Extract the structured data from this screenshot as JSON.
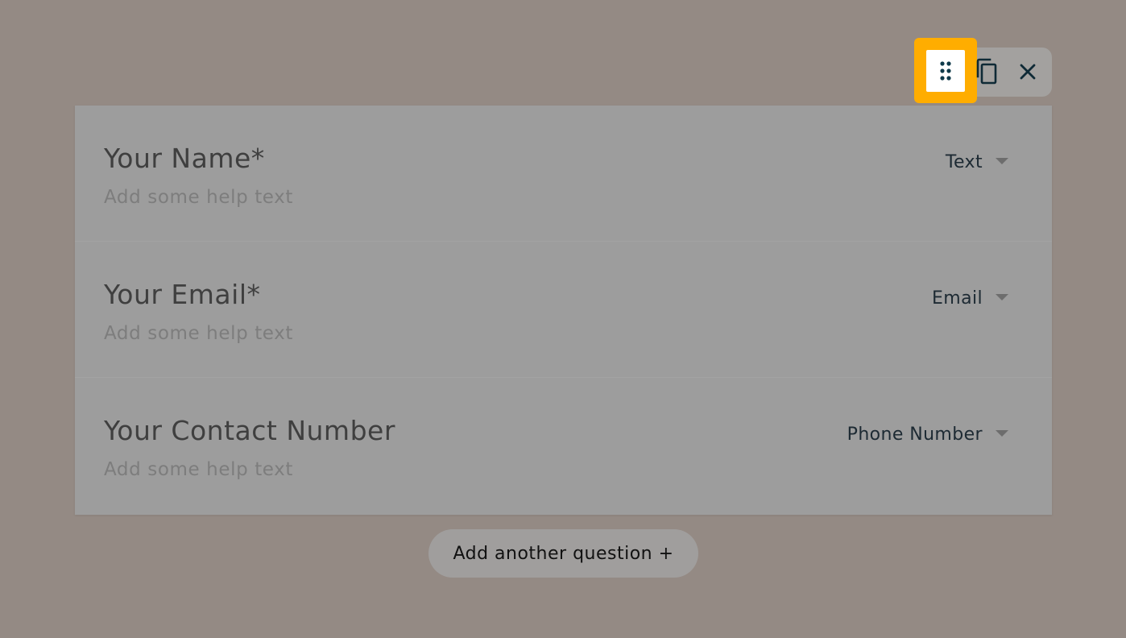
{
  "toolbar": {
    "drag_icon": "drag-handle-icon",
    "copy_icon": "copy-icon",
    "close_icon": "close-icon",
    "highlight_color": "#ffad00"
  },
  "questions": [
    {
      "title": "Your Name*",
      "help_placeholder": "Add some help text",
      "type": "Text"
    },
    {
      "title": "Your Email*",
      "help_placeholder": "Add some help text",
      "type": "Email"
    },
    {
      "title": "Your Contact Number",
      "help_placeholder": "Add some help text",
      "type": "Phone Number"
    }
  ],
  "add_question_label": "Add another question +"
}
